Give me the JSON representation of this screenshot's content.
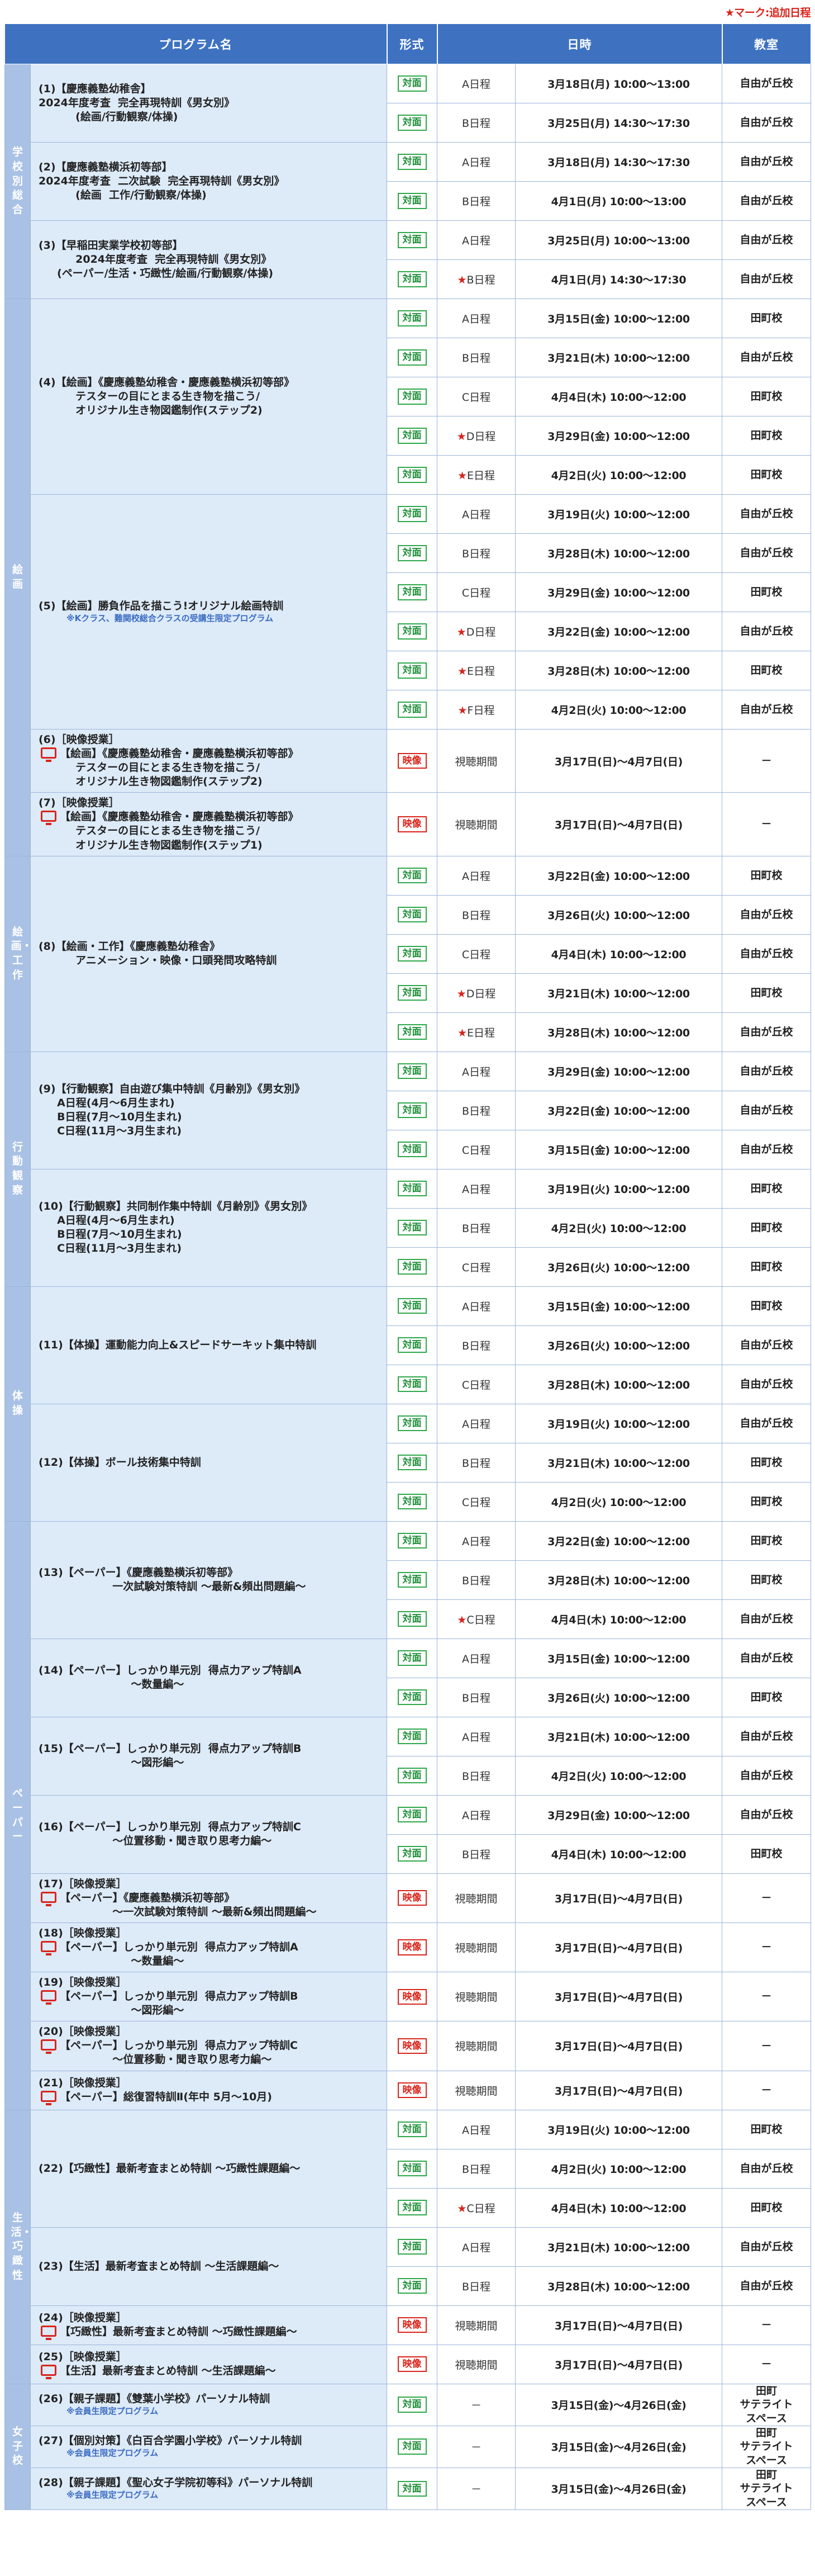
{
  "note": "★マーク:追加日程",
  "headers": {
    "program": "プログラム名",
    "format": "形式",
    "date": "日時",
    "room": "教室"
  },
  "groups": [
    {
      "cat": "学校別総合",
      "programs": [
        {
          "lines": [
            "(1)【慶應義塾幼稚舎】",
            "2024年度考査  完全再現特訓《男女別》",
            "          (絵画/行動観察/体操)"
          ],
          "sessions": [
            {
              "format": "対面",
              "sched": "A日程",
              "star": false,
              "date": "3月18日(月) 10:00～13:00",
              "room": "自由が丘校"
            },
            {
              "format": "対面",
              "sched": "B日程",
              "star": false,
              "date": "3月25日(月) 14:30～17:30",
              "room": "自由が丘校"
            }
          ]
        },
        {
          "lines": [
            "(2)【慶應義塾横浜初等部】",
            "2024年度考査  二次試験  完全再現特訓《男女別》",
            "          (絵画  工作/行動観察/体操)"
          ],
          "sessions": [
            {
              "format": "対面",
              "sched": "A日程",
              "star": false,
              "date": "3月18日(月) 14:30～17:30",
              "room": "自由が丘校"
            },
            {
              "format": "対面",
              "sched": "B日程",
              "star": false,
              "date": "4月1日(月) 10:00～13:00",
              "room": "自由が丘校"
            }
          ]
        },
        {
          "lines": [
            "(3)【早稲田実業学校初等部】",
            "          2024年度考査  完全再現特訓《男女別》",
            "     (ペーパー/生活・巧緻性/絵画/行動観察/体操)"
          ],
          "sessions": [
            {
              "format": "対面",
              "sched": "A日程",
              "star": false,
              "date": "3月25日(月) 10:00～13:00",
              "room": "自由が丘校"
            },
            {
              "format": "対面",
              "sched": "B日程",
              "star": true,
              "date": "4月1日(月) 14:30～17:30",
              "room": "自由が丘校"
            }
          ]
        }
      ]
    },
    {
      "cat": "絵画",
      "programs": [
        {
          "lines": [
            "(4)【絵画】《慶應義塾幼稚舎・慶應義塾横浜初等部》",
            "          テスターの目にとまる生き物を描こう/",
            "          オリジナル生き物図鑑制作(ステップ2)"
          ],
          "sessions": [
            {
              "format": "対面",
              "sched": "A日程",
              "star": false,
              "date": "3月15日(金) 10:00～12:00",
              "room": "田町校"
            },
            {
              "format": "対面",
              "sched": "B日程",
              "star": false,
              "date": "3月21日(木) 10:00～12:00",
              "room": "自由が丘校"
            },
            {
              "format": "対面",
              "sched": "C日程",
              "star": false,
              "date": "4月4日(木) 10:00～12:00",
              "room": "田町校"
            },
            {
              "format": "対面",
              "sched": "D日程",
              "star": true,
              "date": "3月29日(金) 10:00～12:00",
              "room": "田町校"
            },
            {
              "format": "対面",
              "sched": "E日程",
              "star": true,
              "date": "4月2日(火) 10:00～12:00",
              "room": "田町校"
            }
          ]
        },
        {
          "lines": [
            "(5)【絵画】勝負作品を描こう!オリジナル絵画特訓"
          ],
          "sub": "※Kクラス、難関校総合クラスの受講生限定プログラム",
          "sessions": [
            {
              "format": "対面",
              "sched": "A日程",
              "star": false,
              "date": "3月19日(火) 10:00～12:00",
              "room": "自由が丘校"
            },
            {
              "format": "対面",
              "sched": "B日程",
              "star": false,
              "date": "3月28日(木) 10:00～12:00",
              "room": "自由が丘校"
            },
            {
              "format": "対面",
              "sched": "C日程",
              "star": false,
              "date": "3月29日(金) 10:00～12:00",
              "room": "田町校"
            },
            {
              "format": "対面",
              "sched": "D日程",
              "star": true,
              "date": "3月22日(金) 10:00～12:00",
              "room": "自由が丘校"
            },
            {
              "format": "対面",
              "sched": "E日程",
              "star": true,
              "date": "3月28日(木) 10:00～12:00",
              "room": "田町校"
            },
            {
              "format": "対面",
              "sched": "F日程",
              "star": true,
              "date": "4月2日(火) 10:00～12:00",
              "room": "自由が丘校"
            }
          ]
        },
        {
          "video": true,
          "lines": [
            "(6)［映像授業］",
            "【絵画】《慶應義塾幼稚舎・慶應義塾横浜初等部》",
            "          テスターの目にとまる生き物を描こう/",
            "          オリジナル生き物図鑑制作(ステップ2)"
          ],
          "sessions": [
            {
              "format": "映像",
              "sched": "視聴期間",
              "star": false,
              "date": "3月17日(日)～4月7日(日)",
              "room": "－"
            }
          ]
        },
        {
          "video": true,
          "lines": [
            "(7)［映像授業］",
            "【絵画】《慶應義塾幼稚舎・慶應義塾横浜初等部》",
            "          テスターの目にとまる生き物を描こう/",
            "          オリジナル生き物図鑑制作(ステップ1)"
          ],
          "sessions": [
            {
              "format": "映像",
              "sched": "視聴期間",
              "star": false,
              "date": "3月17日(日)～4月7日(日)",
              "room": "－"
            }
          ]
        }
      ]
    },
    {
      "cat": "絵画・工作",
      "programs": [
        {
          "lines": [
            "(8)【絵画・工作】《慶應義塾幼稚舎》",
            "          アニメーション・映像・口頭発問攻略特訓"
          ],
          "sessions": [
            {
              "format": "対面",
              "sched": "A日程",
              "star": false,
              "date": "3月22日(金) 10:00～12:00",
              "room": "田町校"
            },
            {
              "format": "対面",
              "sched": "B日程",
              "star": false,
              "date": "3月26日(火) 10:00～12:00",
              "room": "自由が丘校"
            },
            {
              "format": "対面",
              "sched": "C日程",
              "star": false,
              "date": "4月4日(木) 10:00～12:00",
              "room": "自由が丘校"
            },
            {
              "format": "対面",
              "sched": "D日程",
              "star": true,
              "date": "3月21日(木) 10:00～12:00",
              "room": "田町校"
            },
            {
              "format": "対面",
              "sched": "E日程",
              "star": true,
              "date": "3月28日(木) 10:00～12:00",
              "room": "自由が丘校"
            }
          ]
        }
      ]
    },
    {
      "cat": "行動観察",
      "programs": [
        {
          "lines": [
            "(9)【行動観察】自由遊び集中特訓《月齢別》《男女別》",
            "",
            "     A日程(4月～6月生まれ)",
            "     B日程(7月～10月生まれ)",
            "     C日程(11月～3月生まれ)"
          ],
          "sessions": [
            {
              "format": "対面",
              "sched": "A日程",
              "star": false,
              "date": "3月29日(金) 10:00～12:00",
              "room": "自由が丘校"
            },
            {
              "format": "対面",
              "sched": "B日程",
              "star": false,
              "date": "3月22日(金) 10:00～12:00",
              "room": "自由が丘校"
            },
            {
              "format": "対面",
              "sched": "C日程",
              "star": false,
              "date": "3月15日(金) 10:00～12:00",
              "room": "自由が丘校"
            }
          ]
        },
        {
          "lines": [
            "(10)【行動観察】共同制作集中特訓《月齢別》《男女別》",
            "",
            "     A日程(4月～6月生まれ)",
            "     B日程(7月～10月生まれ)",
            "     C日程(11月～3月生まれ)"
          ],
          "sessions": [
            {
              "format": "対面",
              "sched": "A日程",
              "star": false,
              "date": "3月19日(火) 10:00～12:00",
              "room": "田町校"
            },
            {
              "format": "対面",
              "sched": "B日程",
              "star": false,
              "date": "4月2日(火) 10:00～12:00",
              "room": "田町校"
            },
            {
              "format": "対面",
              "sched": "C日程",
              "star": false,
              "date": "3月26日(火) 10:00～12:00",
              "room": "田町校"
            }
          ]
        }
      ]
    },
    {
      "cat": "体操",
      "programs": [
        {
          "lines": [
            "(11)【体操】運動能力向上&スピードサーキット集中特訓"
          ],
          "sessions": [
            {
              "format": "対面",
              "sched": "A日程",
              "star": false,
              "date": "3月15日(金) 10:00～12:00",
              "room": "田町校"
            },
            {
              "format": "対面",
              "sched": "B日程",
              "star": false,
              "date": "3月26日(火) 10:00～12:00",
              "room": "自由が丘校"
            },
            {
              "format": "対面",
              "sched": "C日程",
              "star": false,
              "date": "3月28日(木) 10:00～12:00",
              "room": "自由が丘校"
            }
          ]
        },
        {
          "lines": [
            "(12)【体操】ボール技術集中特訓"
          ],
          "sessions": [
            {
              "format": "対面",
              "sched": "A日程",
              "star": false,
              "date": "3月19日(火) 10:00～12:00",
              "room": "自由が丘校"
            },
            {
              "format": "対面",
              "sched": "B日程",
              "star": false,
              "date": "3月21日(木) 10:00～12:00",
              "room": "田町校"
            },
            {
              "format": "対面",
              "sched": "C日程",
              "star": false,
              "date": "4月2日(火) 10:00～12:00",
              "room": "田町校"
            }
          ]
        }
      ]
    },
    {
      "cat": "ペーパー",
      "programs": [
        {
          "lines": [
            "(13)【ペーパー】《慶應義塾横浜初等部》",
            "                    一次試験対策特訓 ～最新&頻出問題編～"
          ],
          "sessions": [
            {
              "format": "対面",
              "sched": "A日程",
              "star": false,
              "date": "3月22日(金) 10:00～12:00",
              "room": "田町校"
            },
            {
              "format": "対面",
              "sched": "B日程",
              "star": false,
              "date": "3月28日(木) 10:00～12:00",
              "room": "田町校"
            },
            {
              "format": "対面",
              "sched": "C日程",
              "star": true,
              "date": "4月4日(木) 10:00～12:00",
              "room": "自由が丘校"
            }
          ]
        },
        {
          "lines": [
            "(14)【ペーパー】しっかり単元別  得点力アップ特訓A",
            "                         ～数量編～"
          ],
          "sessions": [
            {
              "format": "対面",
              "sched": "A日程",
              "star": false,
              "date": "3月15日(金) 10:00～12:00",
              "room": "自由が丘校"
            },
            {
              "format": "対面",
              "sched": "B日程",
              "star": false,
              "date": "3月26日(火) 10:00～12:00",
              "room": "田町校"
            }
          ]
        },
        {
          "lines": [
            "(15)【ペーパー】しっかり単元別  得点力アップ特訓B",
            "                         ～図形編～"
          ],
          "sessions": [
            {
              "format": "対面",
              "sched": "A日程",
              "star": false,
              "date": "3月21日(木) 10:00～12:00",
              "room": "自由が丘校"
            },
            {
              "format": "対面",
              "sched": "B日程",
              "star": false,
              "date": "4月2日(火) 10:00～12:00",
              "room": "自由が丘校"
            }
          ]
        },
        {
          "lines": [
            "(16)【ペーパー】しっかり単元別  得点力アップ特訓C",
            "                    ～位置移動・聞き取り思考力編～"
          ],
          "sessions": [
            {
              "format": "対面",
              "sched": "A日程",
              "star": false,
              "date": "3月29日(金) 10:00～12:00",
              "room": "自由が丘校"
            },
            {
              "format": "対面",
              "sched": "B日程",
              "star": false,
              "date": "4月4日(木) 10:00～12:00",
              "room": "田町校"
            }
          ]
        },
        {
          "video": true,
          "lines": [
            "(17)［映像授業］",
            "【ペーパー】《慶應義塾横浜初等部》",
            "                    ～一次試験対策特訓 ～最新&頻出問題編～"
          ],
          "sessions": [
            {
              "format": "映像",
              "sched": "視聴期間",
              "star": false,
              "date": "3月17日(日)～4月7日(日)",
              "room": "－"
            }
          ]
        },
        {
          "video": true,
          "lines": [
            "(18)［映像授業］",
            "【ペーパー】しっかり単元別  得点力アップ特訓A",
            "                         ～数量編～"
          ],
          "sessions": [
            {
              "format": "映像",
              "sched": "視聴期間",
              "star": false,
              "date": "3月17日(日)～4月7日(日)",
              "room": "－"
            }
          ]
        },
        {
          "video": true,
          "lines": [
            "(19)［映像授業］",
            "【ペーパー】しっかり単元別  得点力アップ特訓B",
            "                         ～図形編～"
          ],
          "sessions": [
            {
              "format": "映像",
              "sched": "視聴期間",
              "star": false,
              "date": "3月17日(日)～4月7日(日)",
              "room": "－"
            }
          ]
        },
        {
          "video": true,
          "lines": [
            "(20)［映像授業］",
            "【ペーパー】しっかり単元別  得点力アップ特訓C",
            "                    ～位置移動・聞き取り思考力編～"
          ],
          "sessions": [
            {
              "format": "映像",
              "sched": "視聴期間",
              "star": false,
              "date": "3月17日(日)～4月7日(日)",
              "room": "－"
            }
          ]
        },
        {
          "video": true,
          "lines": [
            "(21)［映像授業］",
            "【ペーパー】総復習特訓Ⅱ(年中 5月～10月)"
          ],
          "sessions": [
            {
              "format": "映像",
              "sched": "視聴期間",
              "star": false,
              "date": "3月17日(日)～4月7日(日)",
              "room": "－"
            }
          ]
        }
      ]
    },
    {
      "cat": "生活・巧緻性",
      "programs": [
        {
          "lines": [
            "(22)【巧緻性】最新考査まとめ特訓 ～巧緻性課題編～"
          ],
          "sessions": [
            {
              "format": "対面",
              "sched": "A日程",
              "star": false,
              "date": "3月19日(火) 10:00～12:00",
              "room": "田町校"
            },
            {
              "format": "対面",
              "sched": "B日程",
              "star": false,
              "date": "4月2日(火) 10:00～12:00",
              "room": "自由が丘校"
            },
            {
              "format": "対面",
              "sched": "C日程",
              "star": true,
              "date": "4月4日(木) 10:00～12:00",
              "room": "田町校"
            }
          ]
        },
        {
          "lines": [
            "(23)【生活】最新考査まとめ特訓 ～生活課題編～"
          ],
          "sessions": [
            {
              "format": "対面",
              "sched": "A日程",
              "star": false,
              "date": "3月21日(木) 10:00～12:00",
              "room": "自由が丘校"
            },
            {
              "format": "対面",
              "sched": "B日程",
              "star": false,
              "date": "3月28日(木) 10:00～12:00",
              "room": "自由が丘校"
            }
          ]
        },
        {
          "video": true,
          "lines": [
            "(24)［映像授業］",
            "【巧緻性】最新考査まとめ特訓 ～巧緻性課題編～"
          ],
          "sessions": [
            {
              "format": "映像",
              "sched": "視聴期間",
              "star": false,
              "date": "3月17日(日)～4月7日(日)",
              "room": "－"
            }
          ]
        },
        {
          "video": true,
          "lines": [
            "(25)［映像授業］",
            "【生活】最新考査まとめ特訓 ～生活課題編～"
          ],
          "sessions": [
            {
              "format": "映像",
              "sched": "視聴期間",
              "star": false,
              "date": "3月17日(日)～4月7日(日)",
              "room": "－"
            }
          ]
        }
      ]
    },
    {
      "cat": "女子校",
      "programs": [
        {
          "lines": [
            "(26)【親子課題】《雙葉小学校》パーソナル特訓"
          ],
          "sub2": "※会員生限定プログラム",
          "sessions": [
            {
              "format": "対面",
              "sched": "－",
              "star": false,
              "date": "3月15日(金)～4月26日(金)",
              "room": "田町\nサテライト\nスペース"
            }
          ]
        },
        {
          "lines": [
            "(27)【個別対策】《白百合学園小学校》パーソナル特訓"
          ],
          "sub2": "※会員生限定プログラム",
          "sessions": [
            {
              "format": "対面",
              "sched": "－",
              "star": false,
              "date": "3月15日(金)～4月26日(金)",
              "room": "田町\nサテライト\nスペース"
            }
          ]
        },
        {
          "lines": [
            "(28)【親子課題】《聖心女子学院初等科》パーソナル特訓"
          ],
          "sub2": "※会員生限定プログラム",
          "sessions": [
            {
              "format": "対面",
              "sched": "－",
              "star": false,
              "date": "3月15日(金)～4月26日(金)",
              "room": "田町\nサテライト\nスペース"
            }
          ]
        }
      ]
    }
  ]
}
